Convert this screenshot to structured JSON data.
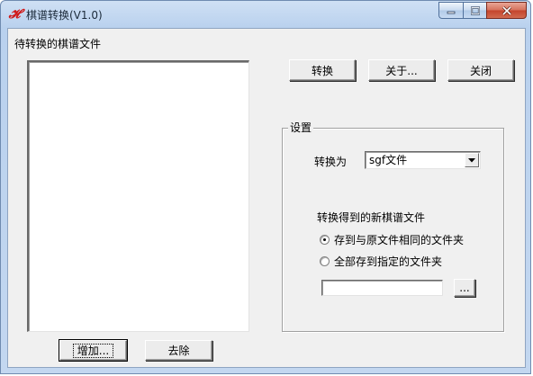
{
  "window": {
    "title": "棋谱转换(V1.0)",
    "app_icon_glyph": "𝓗",
    "accent_title_color": "#d01818"
  },
  "left": {
    "list_label": "待转换的棋谱文件",
    "add_button": "增加...",
    "remove_button": "去除"
  },
  "actions": {
    "convert": "转换",
    "about": "关于...",
    "close": "关闭"
  },
  "settings": {
    "group_title": "设置",
    "convert_to_label": "转换为",
    "format_selected": "sgf文件",
    "output_heading": "转换得到的新棋谱文件",
    "options": [
      {
        "label": "存到与原文件相同的文件夹",
        "checked": true
      },
      {
        "label": "全部存到指定的文件夹",
        "checked": false
      }
    ],
    "folder_path": "",
    "browse_button": "..."
  },
  "icons": {
    "app": "app-icon",
    "minimize": "minimize-icon",
    "maximize": "maximize-icon",
    "close": "close-icon",
    "dropdown": "chevron-down-icon"
  }
}
